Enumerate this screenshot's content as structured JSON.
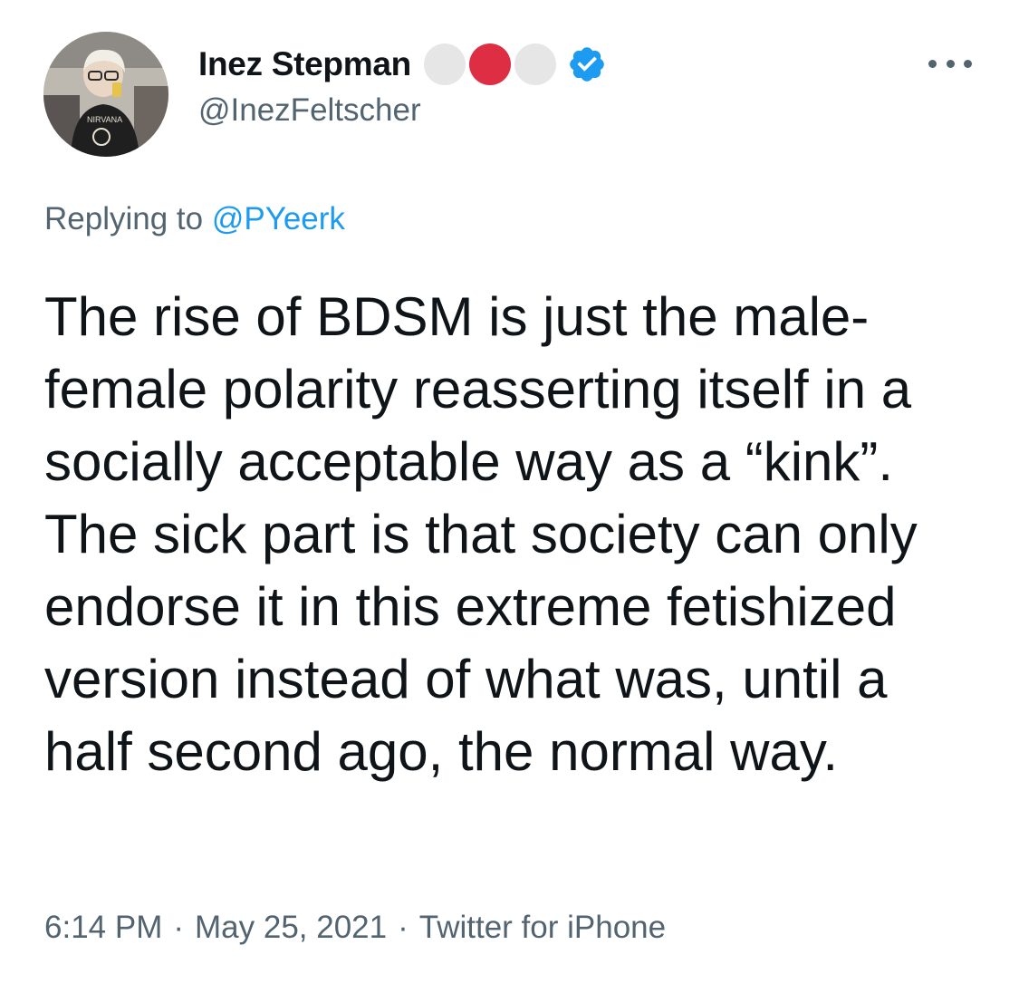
{
  "author": {
    "display_name": "Inez Stepman",
    "handle": "@InezFeltscher",
    "verified": true,
    "emoji_circles": [
      {
        "name": "white-circle",
        "color": "#e6e6e6"
      },
      {
        "name": "red-circle",
        "color": "#dd2e44"
      },
      {
        "name": "white-circle",
        "color": "#e6e6e6"
      }
    ]
  },
  "reply": {
    "prefix": "Replying to ",
    "handle": "@PYeerk"
  },
  "tweet": {
    "text": "The rise of BDSM is just the male-female polarity reasserting itself in a socially acceptable way as a “kink”. The sick part is that society can only endorse it in this extreme fetishized version instead of what was, until a half second ago, the normal way."
  },
  "meta": {
    "time": "6:14 PM",
    "separator": "·",
    "date": "May 25, 2021",
    "source": "Twitter for iPhone"
  },
  "colors": {
    "primary_text": "#0f1419",
    "secondary_text": "#536471",
    "link": "#1d9bf0",
    "verified_badge": "#1d9bf0"
  },
  "icons": {
    "more": "more-icon",
    "verified": "verified-badge-icon"
  }
}
